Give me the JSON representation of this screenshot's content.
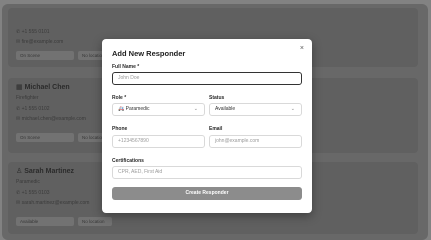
{
  "background_cards": [
    {
      "name": "",
      "role": "",
      "phone": "+1 555 0101",
      "email": "fire@example.com",
      "status": "On Scene",
      "assignment": "No location"
    },
    {
      "name": "Michael Chen",
      "role": "Firefighter",
      "phone": "+1 555 0102",
      "email": "michael.chen@example.com",
      "status": "On Scene",
      "assignment": "No location"
    },
    {
      "name": "Sarah Martinez",
      "role": "Paramedic",
      "phone": "+1 555 0103",
      "email": "sarah.martinez@example.com",
      "status": "Available",
      "assignment": "No location"
    }
  ],
  "modal": {
    "title": "Add New Responder",
    "close_icon": "×",
    "full_name_label": "Full Name *",
    "full_name_placeholder": "John Doe",
    "role_label": "Role *",
    "role_value": "Paramedic",
    "role_icon": "🚑",
    "status_label": "Status",
    "status_value": "Available",
    "phone_label": "Phone",
    "phone_placeholder": "+1234567890",
    "email_label": "Email",
    "email_placeholder": "john@example.com",
    "certifications_label": "Certifications",
    "certifications_placeholder": "CPR, AED, First Aid",
    "submit_label": "Create Responder"
  }
}
